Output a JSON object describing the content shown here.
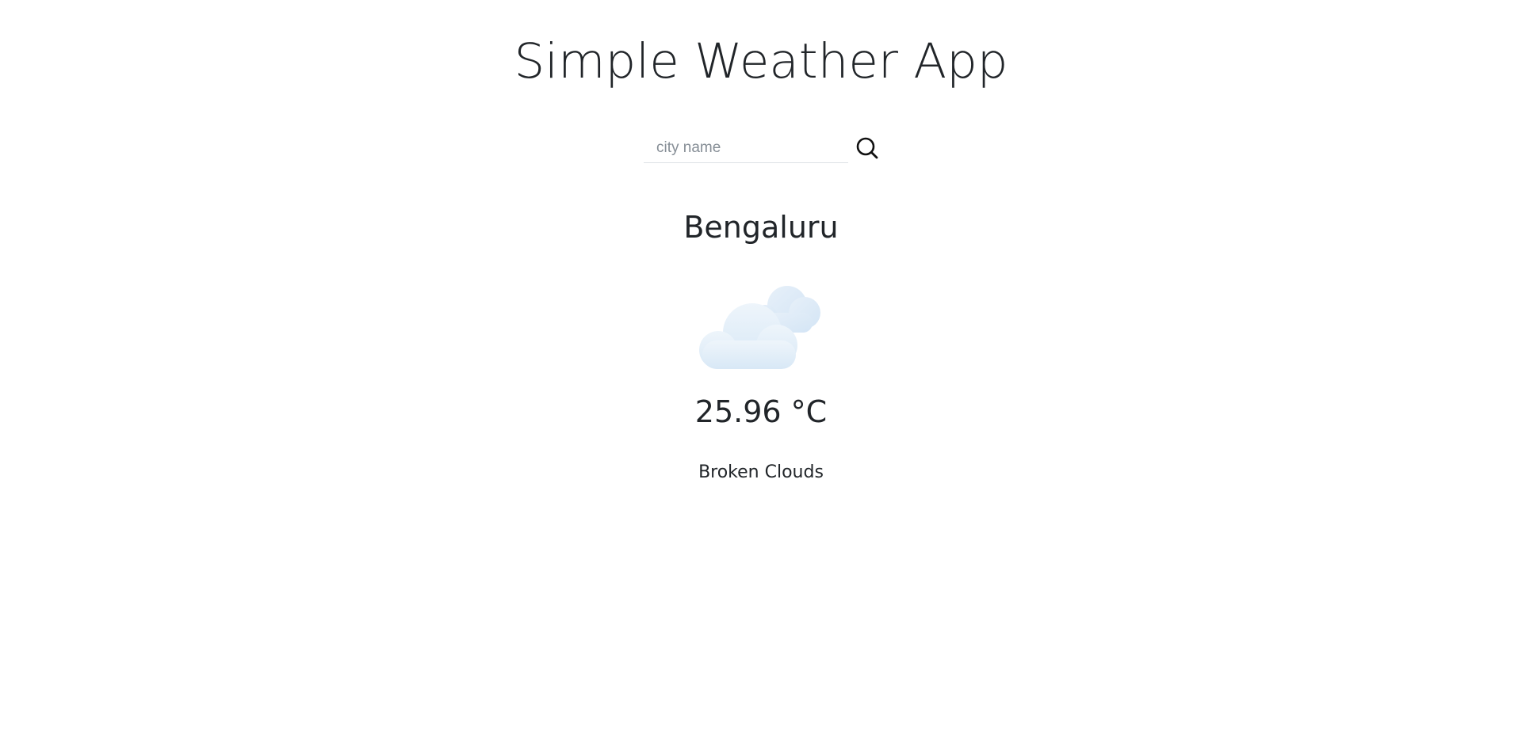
{
  "app": {
    "title": "Simple Weather App"
  },
  "search": {
    "placeholder": "city name",
    "value": "",
    "button_icon": "search-icon"
  },
  "weather": {
    "city": "Bengaluru",
    "icon": "broken-clouds-icon",
    "temperature": "25.96 °C",
    "condition": "Broken Clouds"
  }
}
